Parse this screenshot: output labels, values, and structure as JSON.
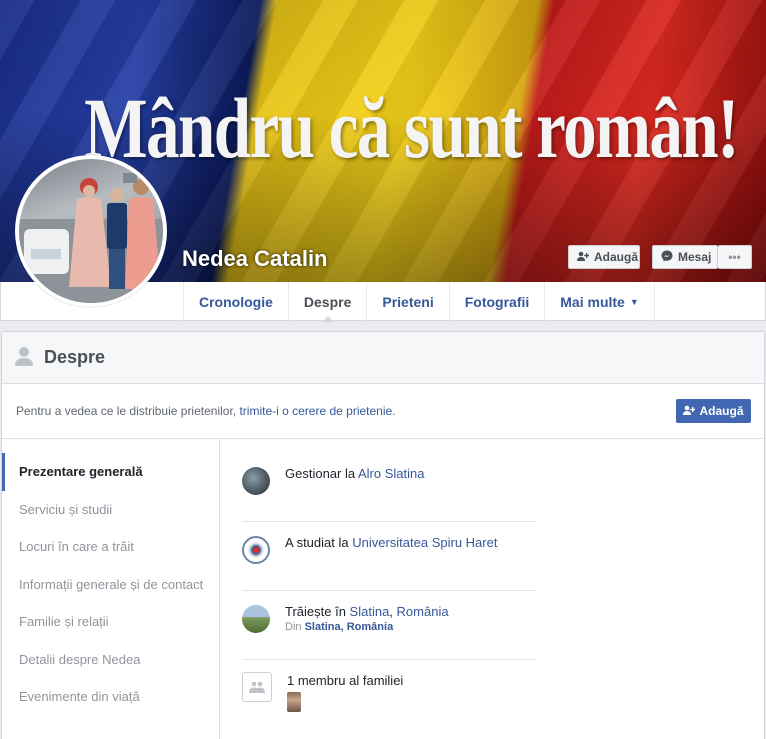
{
  "cover": {
    "slogan": "Mândru că sunt român!",
    "profile_name": "Nedea Catalin",
    "buttons": {
      "add": "Adaugă",
      "message": "Mesaj",
      "more": "•••"
    }
  },
  "nav": {
    "tabs": [
      {
        "label": "Cronologie"
      },
      {
        "label": "Despre"
      },
      {
        "label": "Prieteni"
      },
      {
        "label": "Fotografii"
      },
      {
        "label": "Mai multe"
      }
    ],
    "active_tab": "Despre"
  },
  "about": {
    "title": "Despre",
    "friend_prompt": {
      "text_before": "Pentru a vedea ce le distribuie prietenilor, ",
      "link": "trimite-i o cerere de prietenie",
      "text_after": ".",
      "button": "Adaugă"
    },
    "menu": [
      {
        "label": "Prezentare generală"
      },
      {
        "label": "Serviciu și studii"
      },
      {
        "label": "Locuri în care a trăit"
      },
      {
        "label": "Informații generale și de contact"
      },
      {
        "label": "Familie și relații"
      },
      {
        "label": "Detalii despre Nedea"
      },
      {
        "label": "Evenimente din viață"
      }
    ],
    "active_menu": "Prezentare generală",
    "overview": {
      "work": {
        "prefix": "Gestionar la ",
        "link": "Alro Slatina"
      },
      "education": {
        "prefix": "A studiat la ",
        "link": "Universitatea Spiru Haret"
      },
      "lives": {
        "prefix": "Trăiește în ",
        "city": "Slatina",
        "sep": ", ",
        "country": "România",
        "from_prefix": "Din ",
        "from": "Slatina, România"
      },
      "family": {
        "text": "1 membru al familiei"
      }
    }
  },
  "colors": {
    "link": "#365899",
    "primary_button": "#4267b2",
    "muted_text": "#90949c"
  }
}
